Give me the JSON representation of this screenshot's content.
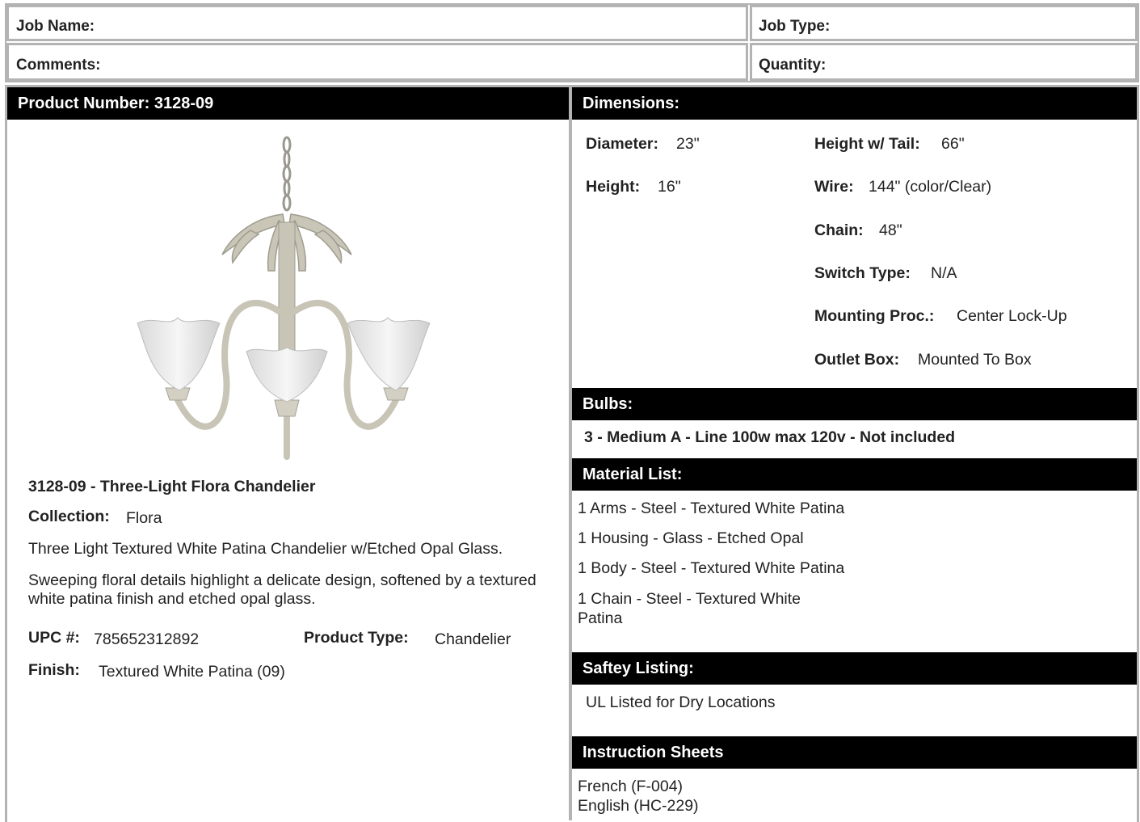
{
  "job": {
    "job_name_label": "Job Name:",
    "job_type_label": "Job Type:",
    "comments_label": "Comments:",
    "quantity_label": "Quantity:"
  },
  "product": {
    "number_header": "Product Number: 3128-09",
    "title": "3128-09 - Three-Light Flora Chandelier",
    "collection_label": "Collection:",
    "collection_value": "Flora",
    "description": "Three Light Textured White Patina Chandelier w/Etched Opal Glass.",
    "feature": "Sweeping floral details highlight a delicate design, softened by a textured white patina finish and etched opal glass.",
    "upc_label": "UPC #:",
    "upc_value": "785652312892",
    "type_label": "Product Type:",
    "type_value": "Chandelier",
    "finish_label": "Finish:",
    "finish_value": "Textured White Patina (09)"
  },
  "dimensions": {
    "header": "Dimensions:",
    "diameter_label": "Diameter:",
    "diameter_value": "23\"",
    "height_label": "Height:",
    "height_value": "16\"",
    "height_tail_label": "Height w/ Tail:",
    "height_tail_value": "66\"",
    "wire_label": "Wire:",
    "wire_value": "144\" (color/Clear)",
    "chain_label": "Chain:",
    "chain_value": "48\"",
    "switch_label": "Switch Type:",
    "switch_value": "N/A",
    "mounting_label": "Mounting Proc.:",
    "mounting_value": "Center Lock-Up",
    "outlet_label": "Outlet Box:",
    "outlet_value": "Mounted To Box"
  },
  "bulbs": {
    "header": "Bulbs:",
    "text": "3 - Medium A - Line 100w max 120v - Not included"
  },
  "materials": {
    "header": "Material List:",
    "items": [
      "1 Arms - Steel - Textured White Patina",
      "1 Housing - Glass - Etched Opal",
      "1 Body - Steel - Textured White Patina",
      "1 Chain - Steel - Textured White",
      "Patina"
    ]
  },
  "safety": {
    "header": "Saftey Listing:",
    "text": "UL Listed for Dry Locations"
  },
  "instructions": {
    "header": "Instruction Sheets",
    "items": [
      "French (F-004)",
      "English (HC-229)"
    ]
  },
  "icons": {
    "product_image": "chandelier-image"
  },
  "colors": {
    "header_bg": "#000000",
    "border": "#b3b3b3"
  }
}
